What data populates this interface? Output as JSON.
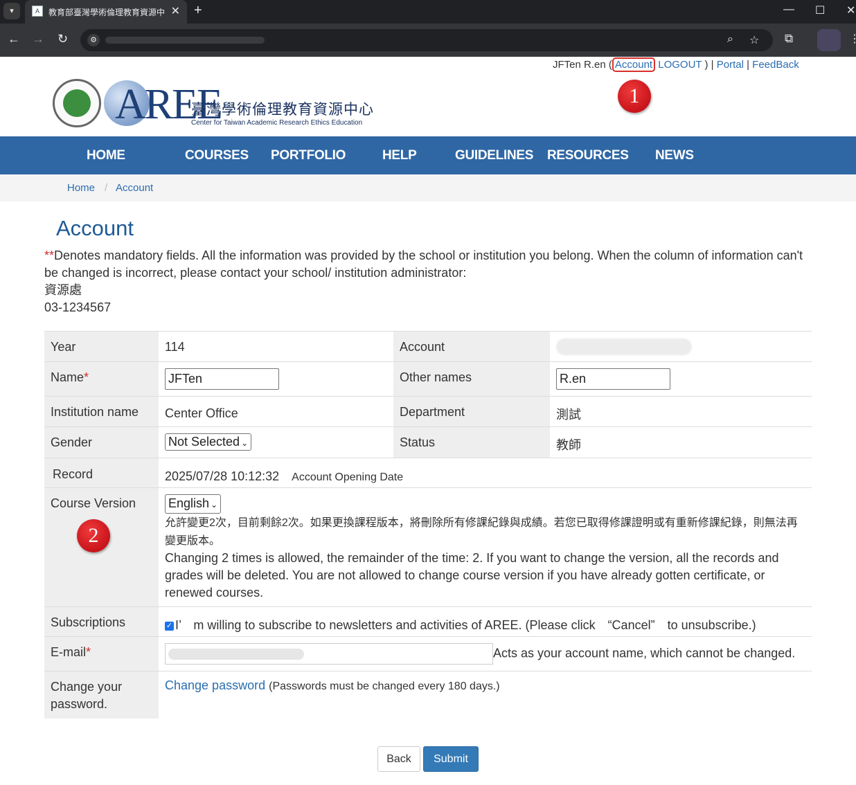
{
  "browser": {
    "tab_title": "教育部臺灣學術倫理教育資源中",
    "tab_close": "✕",
    "new_tab": "+",
    "minimize": "—",
    "maximize": "☐",
    "close": "✕"
  },
  "userbar": {
    "user_name": "JFTen R.en (",
    "account_link": "Account",
    "logout_link": "LOGOUT",
    "close_paren": ") |",
    "portal_link": "Portal",
    "sep": "|",
    "feedback_link": "FeedBack"
  },
  "markers": {
    "first": "1",
    "second": "2"
  },
  "logo": {
    "name": "AREE",
    "zh": "臺灣學術倫理教育資源中心",
    "en": "Center for Taiwan Academic Research Ethics Education"
  },
  "nav": {
    "home": "HOME",
    "courses": "COURSES",
    "portfolio": "PORTFOLIO",
    "help": "HELP",
    "guidelines": "GUIDELINES",
    "resources": "RESOURCES",
    "news": "NEWS"
  },
  "breadcrumb": {
    "home": "Home",
    "sep": "/",
    "current": "Account"
  },
  "page_title": "Account",
  "notice": {
    "stars": "**",
    "text": "Denotes mandatory fields. All the information was provided by the school or institution you belong. When the column of information can't be changed is incorrect, please contact your school/ institution administrator:",
    "contact_unit": "資源處",
    "contact_phone": "03-1234567"
  },
  "form": {
    "year_label": "Year",
    "year_value": "114",
    "account_label": "Account",
    "name_label": "Name",
    "req_mark": "*",
    "name_value": "JFTen",
    "other_names_label": "Other names",
    "other_names_value": "R.en",
    "institution_label": "Institution name",
    "institution_value": "Center Office",
    "department_label": "Department",
    "department_value": "測試",
    "gender_label": "Gender",
    "gender_value": "Not Selected",
    "status_label": "Status",
    "status_value": "教師",
    "record_label": "Record",
    "record_value": "2025/07/28 10:12:32",
    "record_note": "Account Opening Date",
    "course_version_label": "Course Version",
    "course_version_value": "English",
    "course_version_note_zh": "允許變更2次，目前剩餘2次。如果更換課程版本，將刪除所有修課紀錄與成績。若您已取得修課證明或有重新修課紀錄，則無法再變更版本。",
    "course_version_note_en": "Changing 2 times is allowed, the remainder of the time: 2. If you want to change the version, all the records and grades will be deleted. You are not allowed to change course version if you have already gotten certificate, or renewed courses.",
    "subscriptions_label": "Subscriptions",
    "subscriptions_checked": true,
    "subscriptions_text": "I’　m willing to subscribe to newsletters and activities of AREE. (Please click　“Cancel”　to unsubscribe.)",
    "email_label": "E-mail",
    "email_note": "Acts as your account name, which cannot be changed.",
    "password_label": "Change your password.",
    "change_password_link": "Change password",
    "password_note": "(Passwords must be changed every 180 days.)"
  },
  "buttons": {
    "back": "Back",
    "submit": "Submit"
  }
}
